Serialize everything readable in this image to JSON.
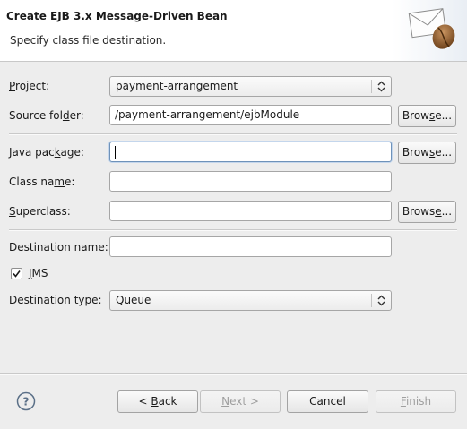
{
  "banner": {
    "title": "Create EJB 3.x Message-Driven Bean",
    "subtitle": "Specify class file destination.",
    "graphic_icon": "envelope-coffee-bean-icon"
  },
  "form": {
    "project": {
      "label_pre": "",
      "label_mnemonic": "P",
      "label_post": "roject:",
      "value": "payment-arrangement"
    },
    "source_folder": {
      "label_pre": "Source fol",
      "label_mnemonic": "d",
      "label_post": "er:",
      "value": "/payment-arrangement/ejbModule",
      "browse_pre": "Brow",
      "browse_mnemonic": "s",
      "browse_post": "e..."
    },
    "java_package": {
      "label_pre": "Java pac",
      "label_mnemonic": "k",
      "label_post": "age:",
      "value": "",
      "browse_pre": "Brow",
      "browse_mnemonic": "s",
      "browse_post": "e..."
    },
    "class_name": {
      "label_pre": "Class na",
      "label_mnemonic": "m",
      "label_post": "e:",
      "value": ""
    },
    "superclass": {
      "label_pre": "",
      "label_mnemonic": "S",
      "label_post": "uperclass:",
      "value": "",
      "browse_pre": "Brows",
      "browse_mnemonic": "e",
      "browse_post": "..."
    },
    "destination_name": {
      "label": "Destination name:",
      "value": ""
    },
    "jms": {
      "label_pre": "",
      "label_mnemonic": "J",
      "label_post": "MS",
      "checked": true
    },
    "destination_type": {
      "label_pre": "Destination ",
      "label_mnemonic": "t",
      "label_post": "ype:",
      "value": "Queue"
    }
  },
  "footer": {
    "help_icon": "help-icon",
    "back": {
      "pre": "< ",
      "mnemonic": "B",
      "post": "ack",
      "enabled": true
    },
    "next": {
      "pre": "",
      "mnemonic": "N",
      "post": "ext >",
      "enabled": false
    },
    "cancel": {
      "label": "Cancel",
      "enabled": true
    },
    "finish": {
      "pre": "",
      "mnemonic": "F",
      "post": "inish",
      "enabled": false
    }
  }
}
